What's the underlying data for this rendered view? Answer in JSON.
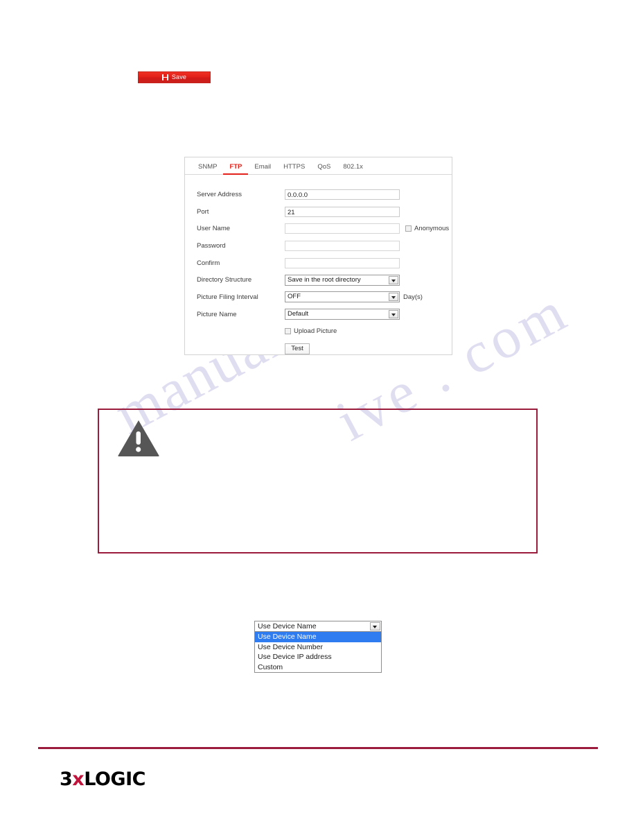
{
  "document": {
    "watermark_left": "manualsh",
    "watermark_right": "ive . com"
  },
  "save_button": {
    "label": "Save",
    "icon": "floppy-disk-icon",
    "color": "#e2211a"
  },
  "panel": {
    "tabs": [
      {
        "label": "SNMP",
        "active": false
      },
      {
        "label": "FTP",
        "active": true
      },
      {
        "label": "Email",
        "active": false
      },
      {
        "label": "HTTPS",
        "active": false
      },
      {
        "label": "QoS",
        "active": false
      },
      {
        "label": "802.1x",
        "active": false
      }
    ],
    "accent_color": "#e2211a",
    "fields": {
      "server_address": {
        "label": "Server Address",
        "value": "0.0.0.0"
      },
      "port": {
        "label": "Port",
        "value": "21"
      },
      "user_name": {
        "label": "User Name",
        "value": ""
      },
      "anonymous": {
        "label": "Anonymous",
        "checked": false
      },
      "password": {
        "label": "Password",
        "value": ""
      },
      "confirm": {
        "label": "Confirm",
        "value": ""
      },
      "directory_structure": {
        "label": "Directory Structure",
        "value": "Save in the root directory"
      },
      "picture_filing_interval": {
        "label": "Picture Filing Interval",
        "value": "OFF",
        "suffix": "Day(s)"
      },
      "picture_name": {
        "label": "Picture Name",
        "value": "Default"
      },
      "upload_picture": {
        "label": "Upload Picture",
        "checked": false
      },
      "test_button": {
        "label": "Test"
      }
    }
  },
  "note_box": {
    "icon": "warning-triangle-icon",
    "border_color": "#9b1b3c",
    "text": ""
  },
  "picture_name_dropdown": {
    "selected": "Use Device Name",
    "options": [
      {
        "label": "Use Device Name",
        "selected": true
      },
      {
        "label": "Use Device Number",
        "selected": false
      },
      {
        "label": "Use Device IP address",
        "selected": false
      },
      {
        "label": "Custom",
        "selected": false
      }
    ],
    "highlight_color": "#2f7bf0"
  },
  "footer": {
    "logo_part1": "3",
    "logo_x": "x",
    "logo_part2": "LOGIC",
    "rule_color": "#9b1b3c"
  }
}
